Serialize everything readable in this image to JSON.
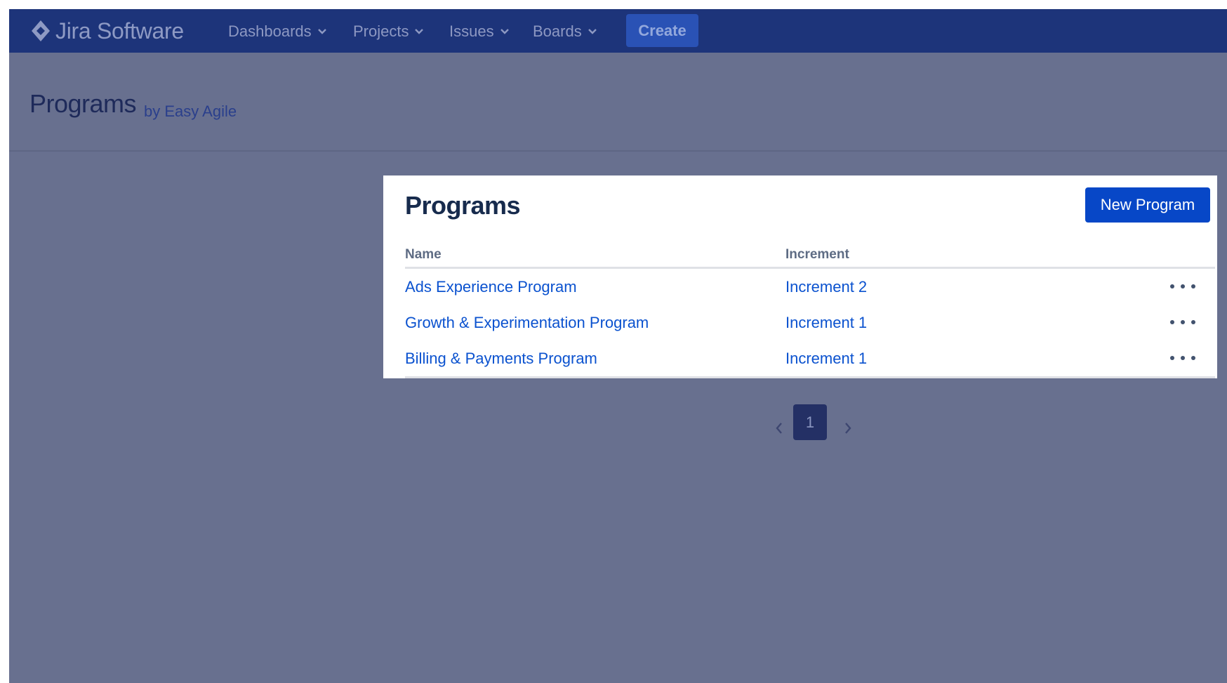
{
  "colors": {
    "nav_bg": "#1d347a",
    "overlay_bg": "#68708f",
    "link": "#0b52cf",
    "primary_button": "#0747c7"
  },
  "nav": {
    "logo_icon": "jira-diamond-icon",
    "product_name": "Jira Software",
    "items": [
      {
        "label": "Dashboards"
      },
      {
        "label": "Projects"
      },
      {
        "label": "Issues"
      },
      {
        "label": "Boards"
      }
    ],
    "create_label": "Create"
  },
  "header": {
    "title": "Programs",
    "subtitle": "by Easy Agile"
  },
  "card": {
    "title": "Programs",
    "new_button_label": "New Program",
    "columns": [
      "Name",
      "Increment"
    ],
    "rows": [
      {
        "name": "Ads Experience Program",
        "increment": "Increment 2"
      },
      {
        "name": "Growth & Experimentation Program",
        "increment": "Increment 1"
      },
      {
        "name": "Billing & Payments Program",
        "increment": "Increment 1"
      }
    ]
  },
  "pagination": {
    "current_page": "1"
  }
}
